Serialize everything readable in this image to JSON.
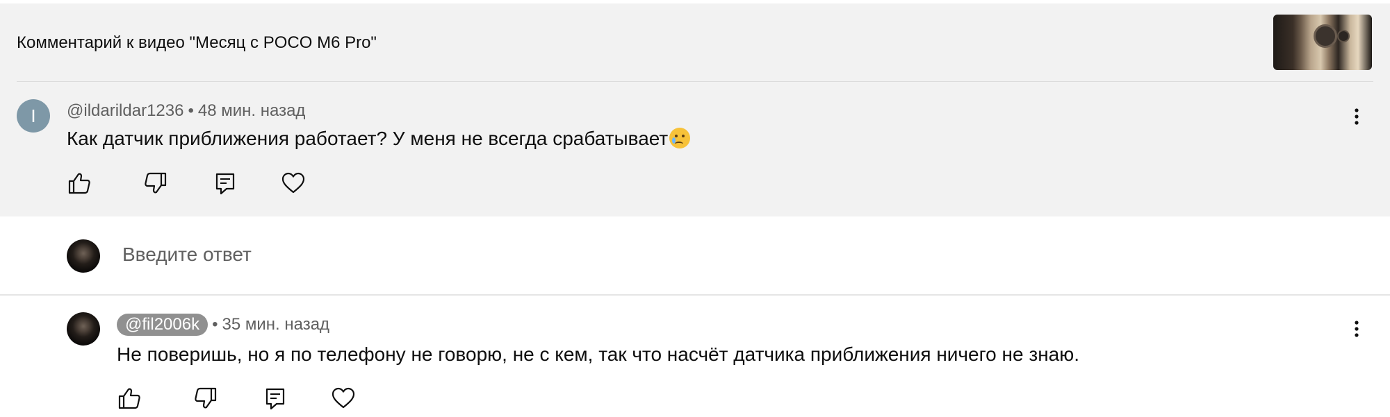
{
  "header": {
    "video_comment_title": "Комментарий к видео \"Месяц с POCO M6 Pro\""
  },
  "comment": {
    "avatar_letter": "I",
    "author": "@ildarildar1236",
    "separator": "•",
    "time": "48 мин. назад",
    "text": "Как датчик приближения  работает?  У меня не всегда срабатывает",
    "emoji": "crying-face-emoji"
  },
  "reply_box": {
    "placeholder": "Введите ответ"
  },
  "reply": {
    "author": "@fil2006k",
    "separator": "•",
    "time": "35 мин. назад",
    "text": "Не поверишь, но я по телефону не говорю, не с кем, так что насчёт датчика приближения ничего не знаю."
  },
  "icons": [
    "thumbs-up-icon",
    "thumbs-down-icon",
    "reply-icon",
    "heart-icon",
    "more-vert-icon"
  ],
  "colors": {
    "highlight_bg": "#f2f2f2",
    "avatar_letter_bg": "#7e98a7",
    "meta_text": "#606060",
    "chip_bg": "#909090"
  }
}
